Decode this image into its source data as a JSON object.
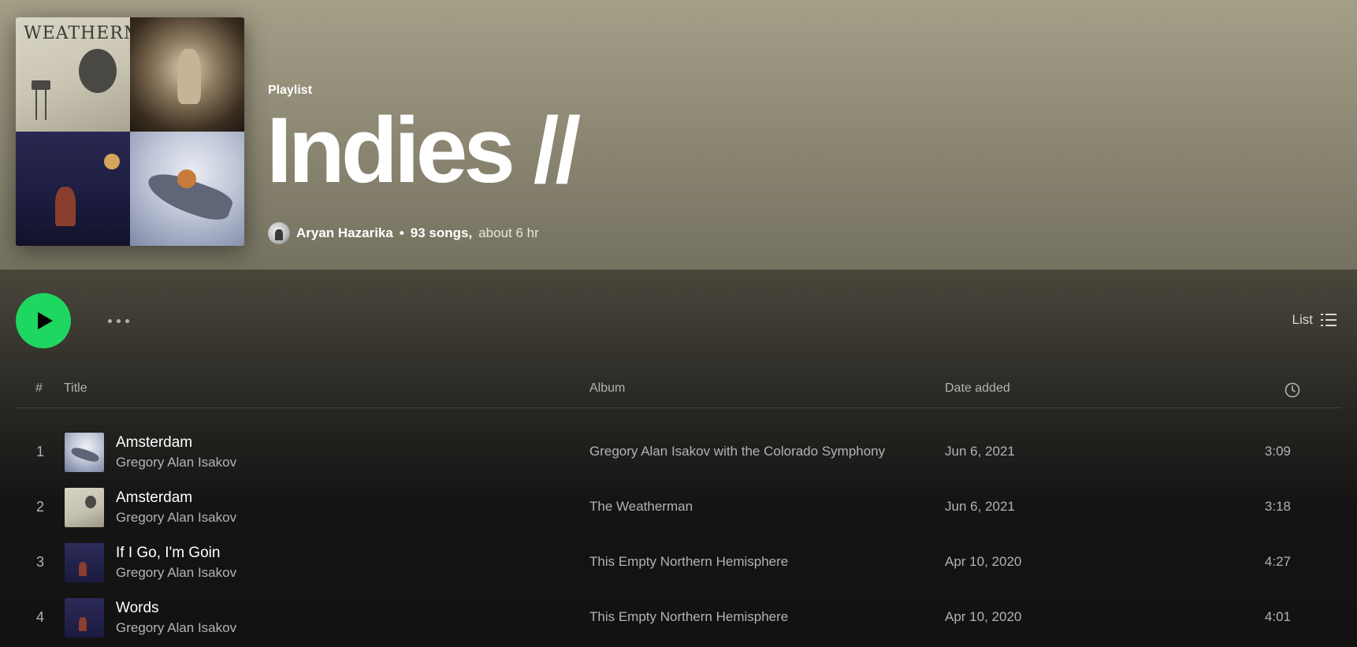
{
  "header": {
    "type_label": "Playlist",
    "title": "Indies //",
    "owner": "Aryan Hazarika",
    "separator": "•",
    "song_count": "93 songs,",
    "duration": "about 6 hr"
  },
  "controls": {
    "play_icon": "play-icon",
    "more_icon": "more-horizontal-icon",
    "view_label": "List",
    "view_icon": "list-icon"
  },
  "table": {
    "headers": {
      "number": "#",
      "title": "Title",
      "album": "Album",
      "date_added": "Date added",
      "duration_icon": "clock-icon"
    },
    "rows": [
      {
        "number": "1",
        "title": "Amsterdam",
        "artist": "Gregory Alan Isakov",
        "album": "Gregory Alan Isakov with the Colorado Symphony",
        "date_added": "Jun 6, 2021",
        "duration": "3:09"
      },
      {
        "number": "2",
        "title": "Amsterdam",
        "artist": "Gregory Alan Isakov",
        "album": "The Weatherman",
        "date_added": "Jun 6, 2021",
        "duration": "3:18"
      },
      {
        "number": "3",
        "title": "If I Go, I'm Goin",
        "artist": "Gregory Alan Isakov",
        "album": "This Empty Northern Hemisphere",
        "date_added": "Apr 10, 2020",
        "duration": "4:27"
      },
      {
        "number": "4",
        "title": "Words",
        "artist": "Gregory Alan Isakov",
        "album": "This Empty Northern Hemisphere",
        "date_added": "Apr 10, 2020",
        "duration": "4:01"
      }
    ]
  },
  "colors": {
    "accent": "#1ed760",
    "hero_bg": "#a59f88",
    "page_bg": "#121212"
  }
}
